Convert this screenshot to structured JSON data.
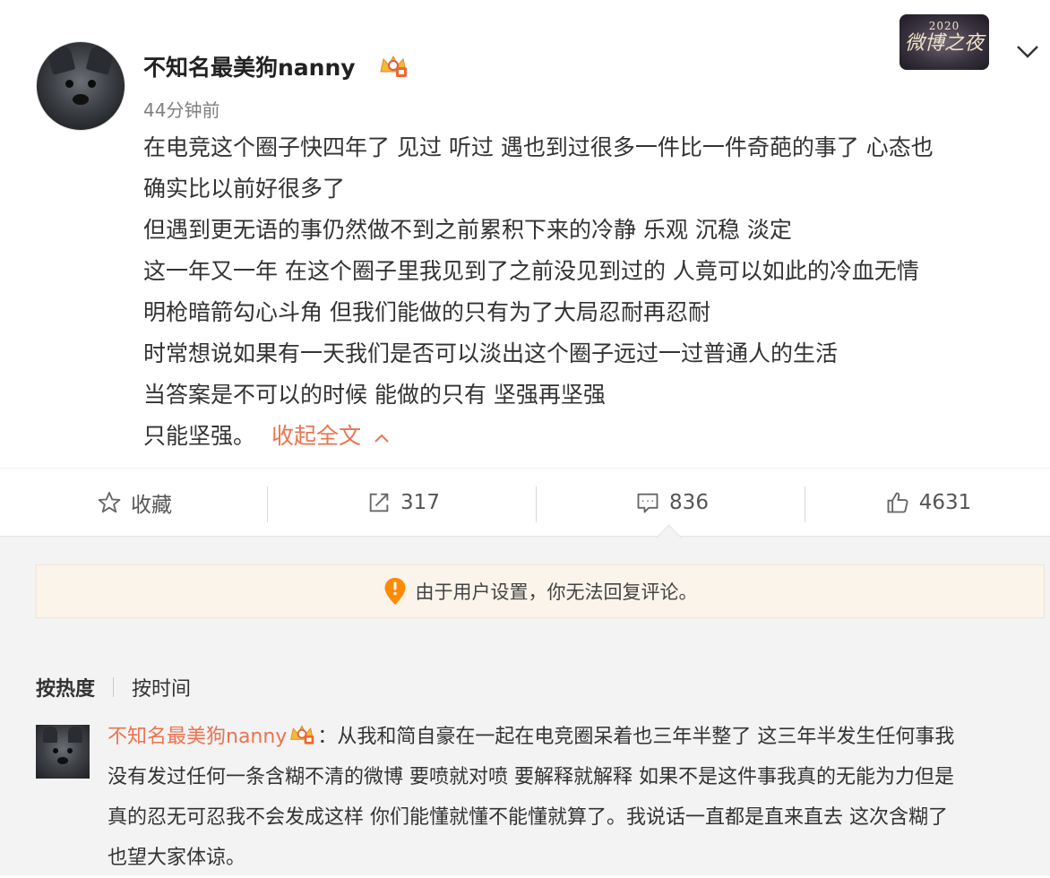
{
  "post": {
    "username": "不知名最美狗nanny",
    "timestamp": "44分钟前",
    "event_logo": {
      "year": "2020",
      "name": "微博之夜"
    },
    "lines": [
      "在电竞这个圈子快四年了 见过 听过 遇也到过很多一件比一件奇葩的事了 心态也",
      "确实比以前好很多了",
      "但遇到更无语的事仍然做不到之前累积下来的冷静 乐观 沉稳 淡定",
      "这一年又一年 在这个圈子里我见到了之前没见到过的 人竟可以如此的冷血无情",
      "明枪暗箭勾心斗角 但我们能做的只有为了大局忍耐再忍耐",
      "时常想说如果有一天我们是否可以淡出这个圈子远过一过普通人的生活",
      "当答案是不可以的时候 能做的只有 坚强再坚强"
    ],
    "last_line": "只能坚强。",
    "collapse_label": "收起全文",
    "accent_color": "#eb7350"
  },
  "actions": {
    "favorite_label": "收藏",
    "repost_count": "317",
    "comment_count": "836",
    "like_count": "4631"
  },
  "notice": {
    "text": "由于用户设置，你无法回复评论。"
  },
  "sort": {
    "hot": "按热度",
    "time": "按时间"
  },
  "comment": {
    "username": "不知名最美狗nanny",
    "colon": "：",
    "first_line": "从我和简自豪在一起在电竞圈呆着也三年半整了 这三年半发生任何事我",
    "lines": [
      "没有发过任何一条含糊不清的微博 要喷就对喷 要解释就解释 如果不是这件事我真的无能为力但是",
      "真的忍无可忍我不会发成这样 你们能懂就懂不能懂就算了。我说话一直都是直来直去 这次含糊了",
      "也望大家体谅。"
    ]
  },
  "icons": {
    "favorite": "star-icon",
    "repost": "share-icon",
    "comment": "comment-icon",
    "like": "thumbs-up-icon",
    "notice": "warning-pin-icon",
    "menu": "chevron-down-icon",
    "badge": "vip-crown-icon"
  }
}
